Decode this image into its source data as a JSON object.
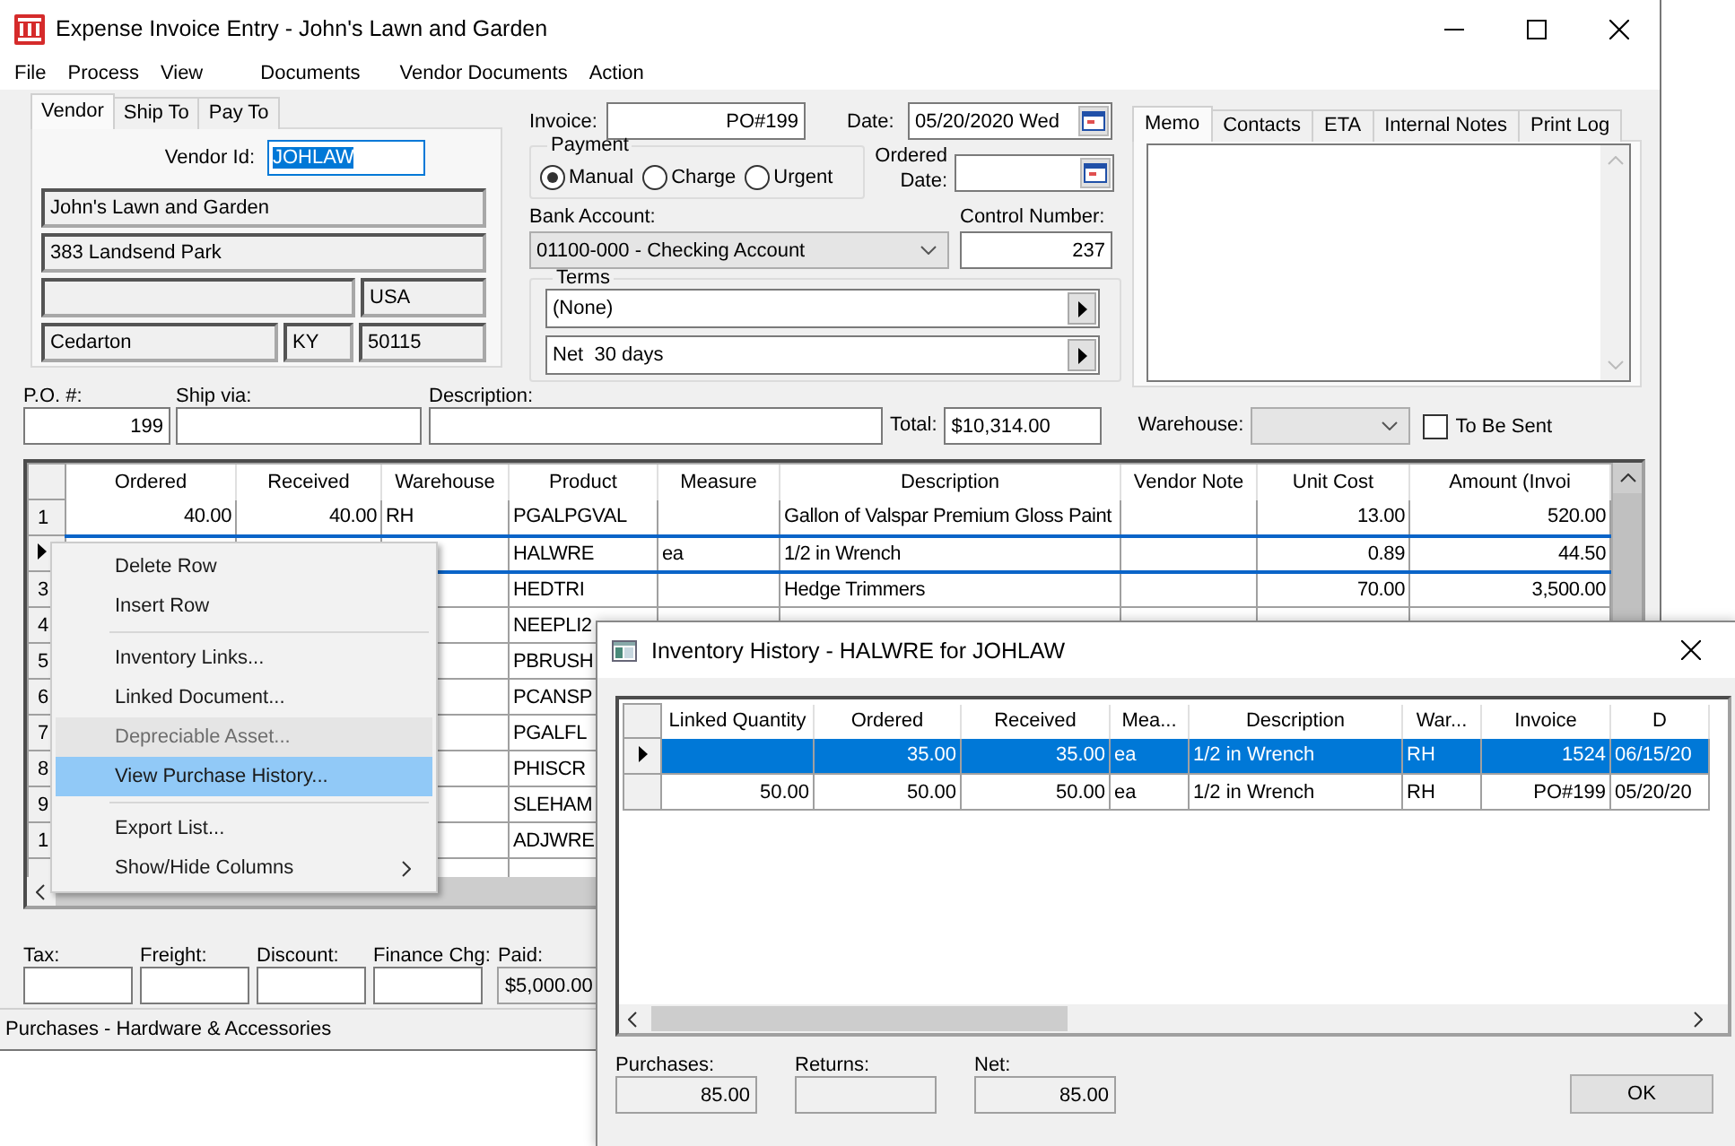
{
  "window": {
    "title": "Expense Invoice Entry - John's Lawn and Garden"
  },
  "menu": [
    "File",
    "Process",
    "View",
    "Documents",
    "Vendor Documents",
    "Action"
  ],
  "vendor_tabs": [
    {
      "label": "Vendor",
      "selected": true
    },
    {
      "label": "Ship To",
      "selected": false
    },
    {
      "label": "Pay To",
      "selected": false
    }
  ],
  "vendor": {
    "id_label": "Vendor Id:",
    "id": "JOHLAW",
    "id_text_selected": true,
    "name": "John's Lawn and Garden",
    "address": "383 Landsend Park",
    "country": "USA",
    "city": "Cedarton",
    "state": "KY",
    "zip": "50115"
  },
  "invoice": {
    "label": "Invoice:",
    "value": "PO#199"
  },
  "date": {
    "label": "Date:",
    "value": "05/20/2020 Wed"
  },
  "payment": {
    "label": "Payment",
    "options": [
      {
        "label": "Manual",
        "selected": true
      },
      {
        "label": "Charge",
        "selected": false
      },
      {
        "label": "Urgent",
        "selected": false
      }
    ]
  },
  "ordered_date": {
    "label": "Ordered Date:"
  },
  "bank_account": {
    "label": "Bank Account:",
    "value": "01100-000 - Checking Account"
  },
  "control_number": {
    "label": "Control Number:",
    "value": "237"
  },
  "terms": {
    "label": "Terms",
    "values": [
      "(None)",
      "Net  30 days"
    ]
  },
  "memo_tabs": [
    {
      "label": "Memo",
      "selected": true
    },
    {
      "label": "Contacts",
      "selected": false
    },
    {
      "label": "ETA",
      "selected": false
    },
    {
      "label": "Internal Notes",
      "selected": false
    },
    {
      "label": "Print Log",
      "selected": false
    }
  ],
  "po": {
    "label": "P.O. #:",
    "value": "199"
  },
  "ship_via": {
    "label": "Ship via:"
  },
  "description": {
    "label": "Description:"
  },
  "total": {
    "label": "Total:",
    "value": "$10,314.00"
  },
  "warehouse": {
    "label": "Warehouse:"
  },
  "to_be_sent": {
    "label": "To Be Sent",
    "checked": false
  },
  "grid": {
    "columns": [
      "Ordered",
      "Received",
      "Warehouse",
      "Product",
      "Measure",
      "Description",
      "Vendor Note",
      "Unit Cost",
      "Amount (Invoi"
    ],
    "rows": [
      {
        "number": "1",
        "selected": false,
        "cells": [
          "40.00",
          "40.00",
          "RH",
          "PGALPGVAL",
          null,
          "Gallon of Valspar Premium Gloss Paint",
          null,
          "13.00",
          "520.00"
        ]
      },
      {
        "selected": true,
        "cells": [
          null,
          null,
          null,
          "HALWRE",
          "ea",
          "1/2 in Wrench",
          null,
          "0.89",
          "44.50"
        ]
      },
      {
        "number": "3",
        "selected": false,
        "cells": [
          null,
          null,
          null,
          "HEDTRI",
          null,
          "Hedge Trimmers",
          null,
          "70.00",
          "3,500.00"
        ]
      },
      {
        "number": "4",
        "selected": false,
        "cells": [
          null,
          null,
          null,
          "NEEPLI2"
        ]
      },
      {
        "number": "5",
        "selected": false,
        "cells": [
          null,
          null,
          null,
          "PBRUSH"
        ]
      },
      {
        "number": "6",
        "selected": false,
        "cells": [
          null,
          null,
          null,
          "PCANSP"
        ]
      },
      {
        "number": "7",
        "selected": false,
        "cells": [
          null,
          null,
          null,
          "PGALFL"
        ]
      },
      {
        "number": "8",
        "selected": false,
        "cells": [
          null,
          null,
          null,
          "PHISCR"
        ]
      },
      {
        "number": "9",
        "selected": false,
        "cells": [
          null,
          null,
          null,
          "SLEHAM"
        ]
      },
      {
        "number": "1",
        "selected": false,
        "cells": [
          null,
          null,
          null,
          "ADJWRE"
        ]
      }
    ]
  },
  "totals": [
    {
      "label": "Tax:"
    },
    {
      "label": "Freight:"
    },
    {
      "label": "Discount:"
    },
    {
      "label": "Finance Chg:"
    },
    {
      "label": "Paid:",
      "value": "$5,000.00"
    }
  ],
  "status_bar": "Purchases - Hardware & Accessories",
  "context_menu": [
    {
      "kind": "item",
      "label": "Delete Row",
      "disabled": false,
      "selected": false
    },
    {
      "kind": "item",
      "label": "Insert Row",
      "disabled": false,
      "selected": false
    },
    {
      "kind": "separator"
    },
    {
      "kind": "item",
      "label": "Inventory Links...",
      "disabled": false,
      "selected": false
    },
    {
      "kind": "item",
      "label": "Linked Document...",
      "disabled": false,
      "selected": false
    },
    {
      "kind": "item",
      "label": "Depreciable Asset...",
      "disabled": true,
      "selected": false
    },
    {
      "kind": "item",
      "label": "View Purchase History...",
      "disabled": false,
      "selected": true
    },
    {
      "kind": "separator"
    },
    {
      "kind": "item",
      "label": "Export List...",
      "disabled": false,
      "selected": false
    },
    {
      "kind": "item",
      "label": "Show/Hide Columns",
      "disabled": false,
      "selected": false,
      "submenu": true
    }
  ],
  "dialog": {
    "title": "Inventory History - HALWRE for JOHLAW",
    "columns": [
      "Linked Quantity",
      "Ordered",
      "Received",
      "Mea...",
      "Description",
      "War...",
      "Invoice",
      "D"
    ],
    "rows": [
      {
        "selected": true,
        "cells": [
          null,
          "35.00",
          "35.00",
          "ea",
          "1/2 in Wrench",
          "RH",
          "1524",
          "06/15/20"
        ]
      },
      {
        "selected": false,
        "cells": [
          "50.00",
          "50.00",
          "50.00",
          "ea",
          "1/2 in Wrench",
          "RH",
          "PO#199",
          "05/20/20"
        ]
      }
    ],
    "summary": [
      {
        "label": "Purchases:",
        "value": "85.00"
      },
      {
        "label": "Returns:"
      },
      {
        "label": "Net:",
        "value": "85.00"
      }
    ],
    "ok_button": "OK"
  }
}
